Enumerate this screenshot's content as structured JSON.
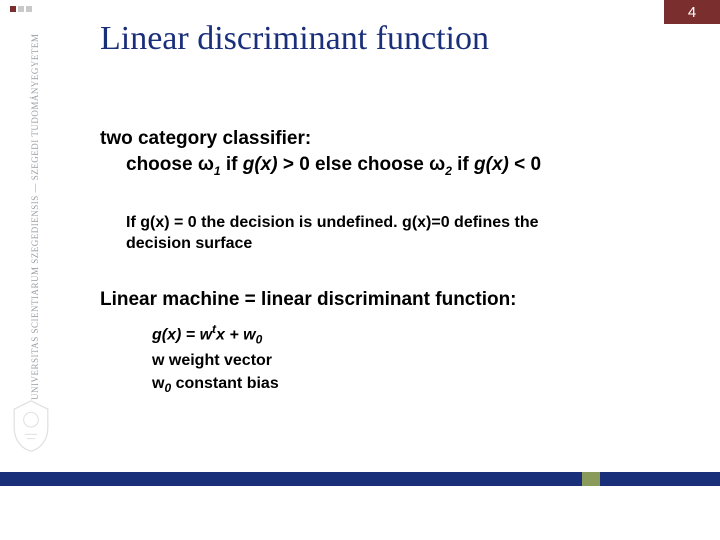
{
  "page_number": "4",
  "sidebar": {
    "institution": "UNIVERSITAS SCIENTIARUM SZEGEDIENSIS — SZEGEDI TUDOMÁNYEGYETEM"
  },
  "title": "Linear discriminant function",
  "classifier": {
    "heading": "two category classifier:",
    "rule_prefix": "choose ",
    "omega": "ω",
    "sub1": "1",
    "if1": " if ",
    "gx": "g(x)",
    "cond1": " > 0 else choose ",
    "sub2": "2",
    "if2": " if ",
    "cond2": " < 0"
  },
  "note": "If g(x) = 0 the decision is undefined. g(x)=0 defines the decision surface",
  "linear": {
    "heading": "Linear machine = linear discriminant function:",
    "eq_lhs": "g(x) = w",
    "eq_sup": "t",
    "eq_mid": "x + w",
    "eq_sub0": "0",
    "w_label": "w weight vector",
    "w0_pre": "w",
    "w0_sub": "0",
    "w0_post": " constant bias"
  }
}
